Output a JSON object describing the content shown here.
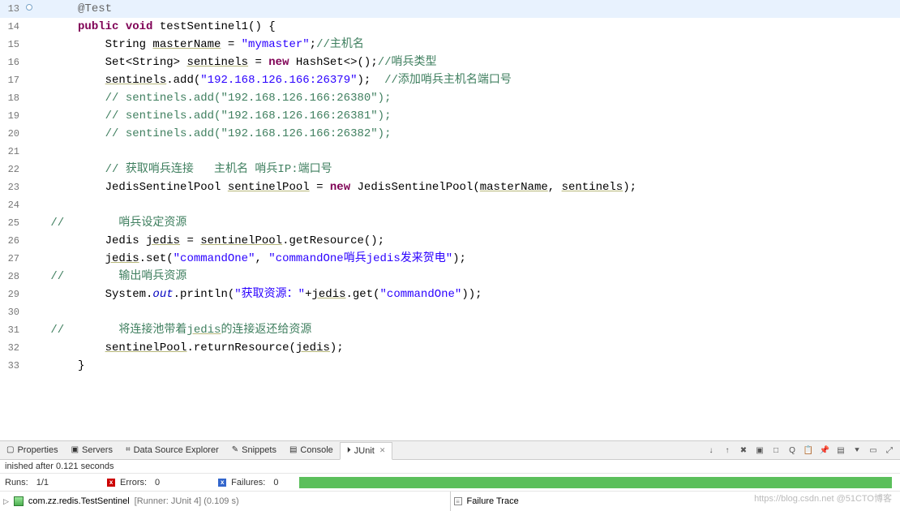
{
  "code": {
    "lines": [
      {
        "n": "13",
        "marker": "circle",
        "hl": true,
        "segs": [
          {
            "t": "     ",
            "c": ""
          },
          {
            "t": "@Test",
            "c": "ann"
          }
        ]
      },
      {
        "n": "14",
        "segs": [
          {
            "t": "     ",
            "c": ""
          },
          {
            "t": "public",
            "c": "k"
          },
          {
            "t": " ",
            "c": ""
          },
          {
            "t": "void",
            "c": "k"
          },
          {
            "t": " testSentinel1() {",
            "c": ""
          }
        ]
      },
      {
        "n": "15",
        "segs": [
          {
            "t": "         String ",
            "c": ""
          },
          {
            "t": "masterName",
            "c": "uvar"
          },
          {
            "t": " = ",
            "c": ""
          },
          {
            "t": "\"mymaster\"",
            "c": "str"
          },
          {
            "t": ";",
            "c": ""
          },
          {
            "t": "//主机名",
            "c": "cm"
          }
        ]
      },
      {
        "n": "16",
        "segs": [
          {
            "t": "         Set<String> ",
            "c": ""
          },
          {
            "t": "sentinels",
            "c": "uvar"
          },
          {
            "t": " = ",
            "c": ""
          },
          {
            "t": "new",
            "c": "k"
          },
          {
            "t": " HashSet<>();",
            "c": ""
          },
          {
            "t": "//哨兵类型",
            "c": "cm"
          }
        ]
      },
      {
        "n": "17",
        "segs": [
          {
            "t": "         ",
            "c": ""
          },
          {
            "t": "sentinels",
            "c": "uvar"
          },
          {
            "t": ".add(",
            "c": ""
          },
          {
            "t": "\"192.168.126.166:26379\"",
            "c": "str"
          },
          {
            "t": ");  ",
            "c": ""
          },
          {
            "t": "//添加哨兵主机名端口号",
            "c": "cm"
          }
        ]
      },
      {
        "n": "18",
        "segs": [
          {
            "t": "         ",
            "c": ""
          },
          {
            "t": "// sentinels.add(\"192.168.126.166:26380\");",
            "c": "cm"
          }
        ]
      },
      {
        "n": "19",
        "segs": [
          {
            "t": "         ",
            "c": ""
          },
          {
            "t": "// sentinels.add(\"192.168.126.166:26381\");",
            "c": "cm"
          }
        ]
      },
      {
        "n": "20",
        "segs": [
          {
            "t": "         ",
            "c": ""
          },
          {
            "t": "// sentinels.add(\"192.168.126.166:26382\");",
            "c": "cm"
          }
        ]
      },
      {
        "n": "21",
        "segs": [
          {
            "t": "         ",
            "c": ""
          }
        ]
      },
      {
        "n": "22",
        "segs": [
          {
            "t": "         ",
            "c": ""
          },
          {
            "t": "// 获取哨兵连接   主机名 哨兵IP:端口号",
            "c": "cm"
          }
        ]
      },
      {
        "n": "23",
        "segs": [
          {
            "t": "         JedisSentinelPool ",
            "c": ""
          },
          {
            "t": "sentinelPool",
            "c": "uvar"
          },
          {
            "t": " = ",
            "c": ""
          },
          {
            "t": "new",
            "c": "k"
          },
          {
            "t": " JedisSentinelPool(",
            "c": ""
          },
          {
            "t": "masterName",
            "c": "uvar"
          },
          {
            "t": ", ",
            "c": ""
          },
          {
            "t": "sentinels",
            "c": "uvar"
          },
          {
            "t": ");",
            "c": ""
          }
        ]
      },
      {
        "n": "24",
        "segs": [
          {
            "t": "         ",
            "c": ""
          }
        ]
      },
      {
        "n": "25",
        "segs": [
          {
            "t": " ",
            "c": ""
          },
          {
            "t": "//        哨兵设定资源",
            "c": "cm"
          }
        ]
      },
      {
        "n": "26",
        "segs": [
          {
            "t": "         Jedis ",
            "c": ""
          },
          {
            "t": "jedis",
            "c": "uvar"
          },
          {
            "t": " = ",
            "c": ""
          },
          {
            "t": "sentinelPool",
            "c": "uvar"
          },
          {
            "t": ".getResource();",
            "c": ""
          }
        ]
      },
      {
        "n": "27",
        "segs": [
          {
            "t": "         ",
            "c": ""
          },
          {
            "t": "jedis",
            "c": "uvar"
          },
          {
            "t": ".set(",
            "c": ""
          },
          {
            "t": "\"commandOne\"",
            "c": "str"
          },
          {
            "t": ", ",
            "c": ""
          },
          {
            "t": "\"commandOne哨兵jedis发来贺电\"",
            "c": "str"
          },
          {
            "t": ");",
            "c": ""
          }
        ]
      },
      {
        "n": "28",
        "segs": [
          {
            "t": " ",
            "c": ""
          },
          {
            "t": "//        输出哨兵资源",
            "c": "cm"
          }
        ]
      },
      {
        "n": "29",
        "segs": [
          {
            "t": "         System.",
            "c": ""
          },
          {
            "t": "out",
            "c": "fld"
          },
          {
            "t": ".println(",
            "c": ""
          },
          {
            "t": "\"获取资源：\"",
            "c": "str"
          },
          {
            "t": "+",
            "c": ""
          },
          {
            "t": "jedis",
            "c": "uvar"
          },
          {
            "t": ".get(",
            "c": ""
          },
          {
            "t": "\"commandOne\"",
            "c": "str"
          },
          {
            "t": "));",
            "c": ""
          }
        ]
      },
      {
        "n": "30",
        "segs": [
          {
            "t": "         ",
            "c": ""
          }
        ]
      },
      {
        "n": "31",
        "segs": [
          {
            "t": " ",
            "c": ""
          },
          {
            "t": "//        将连接池带着",
            "c": "cm"
          },
          {
            "t": "jedis",
            "c": "cm uvar"
          },
          {
            "t": "的连接返还给资源",
            "c": "cm"
          }
        ]
      },
      {
        "n": "32",
        "segs": [
          {
            "t": "         ",
            "c": ""
          },
          {
            "t": "sentinelPool",
            "c": "uvar"
          },
          {
            "t": ".returnResource(",
            "c": ""
          },
          {
            "t": "jedis",
            "c": "uvar"
          },
          {
            "t": ");",
            "c": ""
          }
        ]
      },
      {
        "n": "33",
        "segs": [
          {
            "t": "     }",
            "c": ""
          }
        ]
      }
    ]
  },
  "tabs": {
    "items": [
      {
        "label": "Properties",
        "icon": "▢"
      },
      {
        "label": "Servers",
        "icon": "▣"
      },
      {
        "label": "Data Source Explorer",
        "icon": "⌗"
      },
      {
        "label": "Snippets",
        "icon": "✎"
      },
      {
        "label": "Console",
        "icon": "▤"
      },
      {
        "label": "JUnit",
        "icon": "⏵",
        "active": true
      }
    ]
  },
  "toolbar_icons": [
    "↓",
    "↑",
    "✖",
    "▣",
    "□",
    "Q",
    "📋",
    "📌",
    "▤",
    "⯆",
    "▭",
    "⤢"
  ],
  "junit": {
    "finished": "inished after 0.121 seconds",
    "runs_label": "Runs:",
    "runs_value": "1/1",
    "errors_label": "Errors:",
    "errors_value": "0",
    "failures_label": "Failures:",
    "failures_value": "0",
    "test_name": "com.zz.redis.TestSentinel",
    "test_meta": "[Runner: JUnit 4] (0.109 s)",
    "failure_trace": "Failure Trace"
  },
  "watermark": "https://blog.csdn.net @51CTO博客"
}
